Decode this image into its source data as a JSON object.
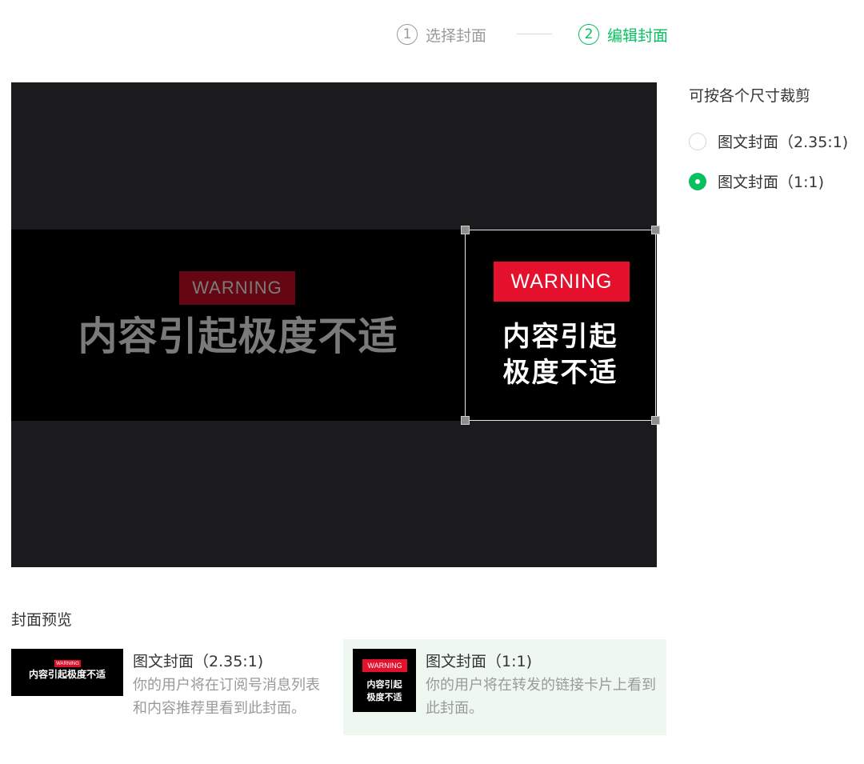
{
  "stepper": {
    "step1": {
      "number": "1",
      "label": "选择封面"
    },
    "step2": {
      "number": "2",
      "label": "编辑封面"
    }
  },
  "colors": {
    "accent": "#07c160",
    "warning_red": "#e5102b",
    "editor_bg": "#1b1b1d"
  },
  "editor": {
    "image_badge": "WARNING",
    "image_headline": "内容引起极度不适",
    "crop_headline_line1": "内容引起",
    "crop_headline_line2": "极度不适"
  },
  "ratio_panel": {
    "title": "可按各个尺寸裁剪",
    "options": [
      {
        "label": "图文封面（2.35:1)",
        "selected": false
      },
      {
        "label": "图文封面（1:1)",
        "selected": true
      }
    ]
  },
  "preview": {
    "title": "封面预览",
    "cards": [
      {
        "label": "图文封面（2.35:1)",
        "description": "你的用户将在订阅号消息列表和内容推荐里看到此封面。"
      },
      {
        "label": "图文封面（1:1)",
        "description": "你的用户将在转发的链接卡片上看到此封面。"
      }
    ]
  }
}
